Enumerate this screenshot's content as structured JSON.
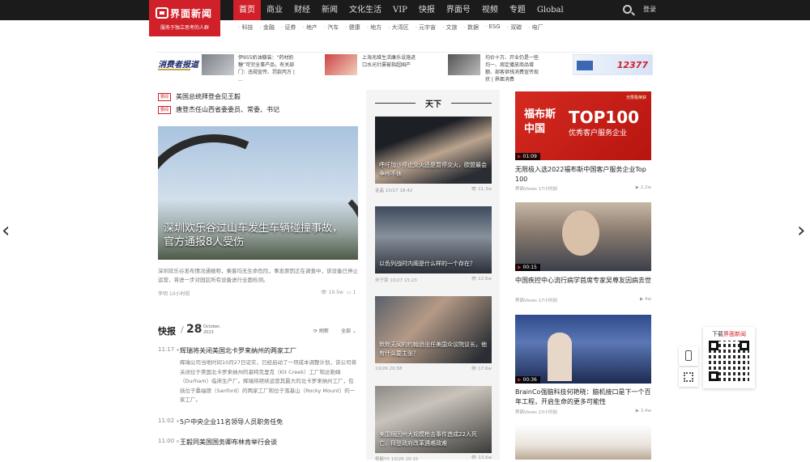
{
  "brand": {
    "name": "界面新闻",
    "slogan": "服务于独立思考的人群"
  },
  "main_nav": [
    "首页",
    "商业",
    "财经",
    "新闻",
    "文化生活",
    "VIP",
    "快报",
    "界面号",
    "视频",
    "专题",
    "Global"
  ],
  "login": "登录",
  "sub_nav": [
    "科技",
    "金融",
    "证券",
    "地产",
    "汽车",
    "健康",
    "地方",
    "大湾区",
    "元宇宙",
    "文旅",
    "数据",
    "ESG",
    "双碳",
    "电厂"
  ],
  "ad_row": {
    "logo": "消费者报道",
    "items": [
      {
        "text": "伊955奶油瓣装：“药材奶糖”可完全事产品，有关部门：违规宣传、罚款丙万 | ..."
      },
      {
        "text": "上海兆维生活康乐设施进口水光针屡被指超国产"
      },
      {
        "text": "均价十万、开业仍是一些均一、周定播放商品增额、部客供钱消费宣传现状 | 界面消费"
      }
    ],
    "banner": "12377"
  },
  "headlines": [
    {
      "tag": "要闻",
      "text": "美国总统拜登会见王毅"
    },
    {
      "tag": "要闻",
      "text": "唐登杰任山西省委委员、常委、书记"
    }
  ],
  "hero": {
    "caption": "深圳欢乐谷过山车发生车辆碰撞事故，官方通报8人受伤",
    "desc": "深圳欢乐谷发布情况通报称，乘客均无生命危险，事发原因正在调查中，该设备已停止运营，将进一步对园区所有设备进行全面检测。",
    "source": "李明 10小时前",
    "views": "19.5w",
    "comments": "1"
  },
  "kuaibao": {
    "title": "快报",
    "day": "28",
    "month": "October,",
    "year": "2023",
    "refresh": "刷新",
    "all": "全部",
    "items": [
      {
        "time": "11:17",
        "text": "辉瑞将关闭美国北卡罗来纳州的两家工厂"
      },
      {
        "time": "11:02",
        "text": "5户中央企业11名领导人员职务任免"
      },
      {
        "time": "11:00",
        "text": "王毅同美国国务卿布林肯举行会谈"
      }
    ],
    "body": "辉瑞公司当地时间10月27日证实，已经启动了一项成本调整计划，该公司将关闭位于美国北卡罗来纳州的基特克里克（Kit Creek）工厂和达勒姆（Durham）临床生产厂。辉瑞将继续运营其最大的北卡罗来纳州工厂，包括位于桑福德（Sanford）的两家工厂和位于落基山（Rocky Mount）的一家工厂。"
  },
  "tianxia": {
    "title": "天下",
    "cards": [
      {
        "caption": "呼吁加沙停止交火还是暂停交火，欧盟最会争吵不休",
        "source": "金晶",
        "date": "10/27 18:42",
        "views": "11.3w"
      },
      {
        "caption": "以色列战时内阁是什么样的一个存在？",
        "source": "刘子豪",
        "date": "10/27 15:23",
        "views": "12.6w"
      },
      {
        "caption": "默默无闻的约翰逊出任美国众议院议长，他有什么要主张？",
        "source": "",
        "date": "10/26 20:58",
        "views": "17.6w"
      },
      {
        "caption": "美国缅因州大规模枪击事件造成22人死亡，拜登政府改革遇难政难",
        "source": "杨敏YX",
        "date": "10/26 20:15",
        "views": "13.6w"
      }
    ]
  },
  "right_col": [
    {
      "duration": "01:09",
      "title": "无限极入选2022福布斯中国客户服务企业Top 100",
      "source": "界面Views",
      "time": "17小时前",
      "views": "2.2w",
      "banner": {
        "line1": "福布斯",
        "line2": "中国",
        "big": "TOP100",
        "sub": "优秀客户服务企业",
        "badge": "无限极荣获"
      }
    },
    {
      "duration": "00:15",
      "title": "中国疾控中心流行病学首席专家吴尊友因病去世",
      "source": "界面Views",
      "time": "17小时前",
      "views": "4w"
    },
    {
      "duration": "00:36",
      "title": "BrainCo强脑科技何艳晓：脑机接口是下一个百年工程，开启生命的更多可能性",
      "source": "界面Views",
      "time": "23小时前",
      "views": "3.4w"
    }
  ],
  "qr": {
    "label_a": "下载",
    "label_b": "界面新闻"
  },
  "colors": {
    "brand_red": "#d0202a",
    "nav_bg": "#1b1b1b"
  }
}
